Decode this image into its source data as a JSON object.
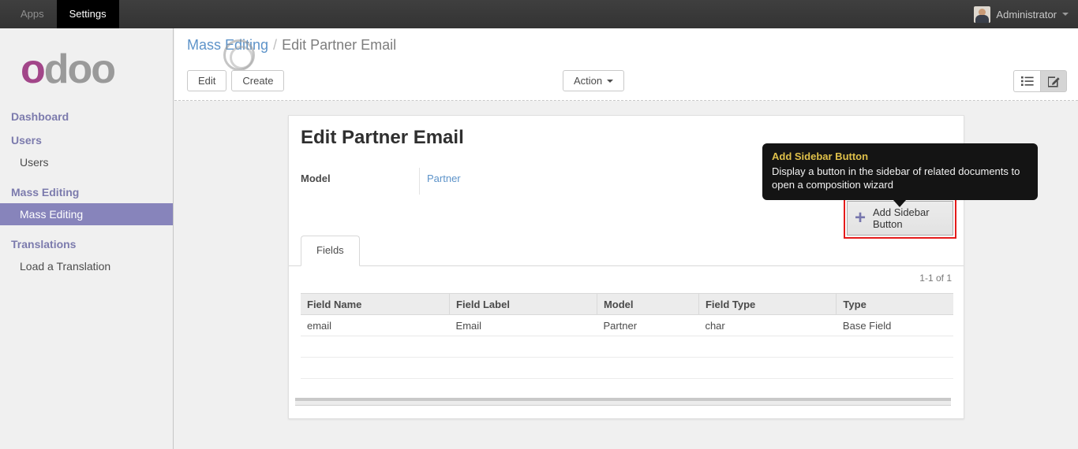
{
  "colors": {
    "topbar_bg": "#383838",
    "active_tab_bg": "#000000",
    "sidebar_heading": "#7c7bad",
    "sidebar_active_bg": "#8784bb",
    "logo_accent": "#a24689",
    "logo_gray": "#9a9a9a",
    "link_blue": "#5d93c9",
    "tooltip_title_color": "#dfc04a",
    "highlight_red": "#e41b1b",
    "plus_icon_purple": "#7776ad"
  },
  "topbar": {
    "tabs": [
      {
        "label": "Apps",
        "active": false
      },
      {
        "label": "Settings",
        "active": true
      }
    ],
    "user": {
      "name": "Administrator"
    }
  },
  "sidebar": {
    "logo_first": "o",
    "logo_rest": "doo",
    "sections": [
      {
        "heading": "Dashboard",
        "items": []
      },
      {
        "heading": "Users",
        "items": [
          {
            "label": "Users",
            "active": false
          }
        ]
      },
      {
        "heading": "Mass Editing",
        "items": [
          {
            "label": "Mass Editing",
            "active": true
          }
        ]
      },
      {
        "heading": "Translations",
        "items": [
          {
            "label": "Load a Translation",
            "active": false
          }
        ]
      }
    ]
  },
  "control_panel": {
    "breadcrumb": {
      "parent": "Mass Editing",
      "separator": "/",
      "current": "Edit Partner Email"
    },
    "edit_label": "Edit",
    "create_label": "Create",
    "action_label": "Action",
    "view_switcher": [
      {
        "name": "list",
        "active": false
      },
      {
        "name": "form",
        "active": true
      }
    ]
  },
  "form": {
    "title": "Edit Partner Email",
    "model": {
      "label": "Model",
      "value": "Partner"
    },
    "add_sidebar_button": {
      "label": "Add Sidebar Button",
      "highlighted": true
    },
    "tooltip": {
      "title": "Add Sidebar Button",
      "body": "Display a button in the sidebar of related documents to open a composition wizard"
    },
    "tabs": [
      {
        "label": "Fields",
        "active": true
      }
    ],
    "pager": "1-1 of 1",
    "fields_table": {
      "headers": [
        "Field Name",
        "Field Label",
        "Model",
        "Field Type",
        "Type"
      ],
      "rows": [
        [
          "email",
          "Email",
          "Partner",
          "char",
          "Base Field"
        ]
      ]
    }
  }
}
